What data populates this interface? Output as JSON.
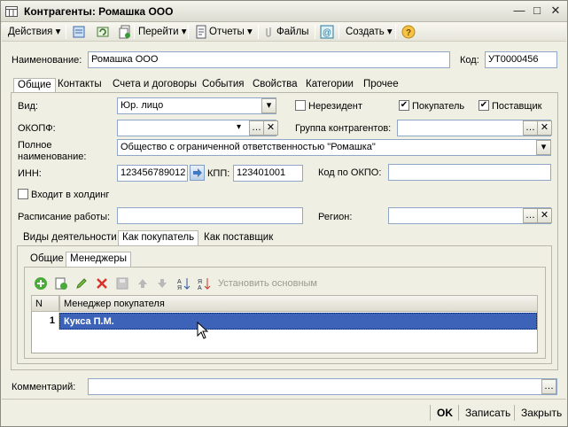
{
  "window": {
    "title": "Контрагенты: Ромашка ООО"
  },
  "toolbar": {
    "actions": "Действия",
    "go": "Перейти",
    "reports": "Отчеты",
    "files": "Файлы",
    "create": "Создать"
  },
  "header": {
    "name_label": "Наименование:",
    "name_value": "Ромашка ООО",
    "code_label": "Код:",
    "code_value": "УТ0000456"
  },
  "tabs": [
    "Общие",
    "Контакты",
    "Счета и договоры",
    "События",
    "Свойства",
    "Категории",
    "Прочее"
  ],
  "general": {
    "type_label": "Вид:",
    "type_value": "Юр. лицо",
    "nonresident_label": "Нерезидент",
    "buyer_label": "Покупатель",
    "supplier_label": "Поставщик",
    "okopf_label": "ОКОПФ:",
    "okopf_value": "",
    "group_label": "Группа контрагентов:",
    "group_value": "",
    "fullname_label": "Полное наименование:",
    "fullname_value": "Общество с ограниченной ответственностью \"Ромашка\"",
    "inn_label": "ИНН:",
    "inn_value": "123456789012",
    "kpp_label": "КПП:",
    "kpp_value": "123401001",
    "okpo_label": "Код по ОКПО:",
    "okpo_value": "",
    "holding_label": "Входит в холдинг",
    "schedule_label": "Расписание работы:",
    "schedule_value": "",
    "region_label": "Регион:",
    "region_value": ""
  },
  "subtabs": [
    "Виды деятельности",
    "Как покупатель",
    "Как поставщик"
  ],
  "innertabs": [
    "Общие",
    "Менеджеры"
  ],
  "managers": {
    "set_main": "Установить основным",
    "col_n": "N",
    "col_manager": "Менеджер покупателя",
    "rows": [
      {
        "n": "1",
        "manager": "Кукса П.М."
      }
    ]
  },
  "comment": {
    "label": "Комментарий:",
    "value": ""
  },
  "footer": {
    "ok": "OK",
    "save": "Записать",
    "close": "Закрыть"
  }
}
